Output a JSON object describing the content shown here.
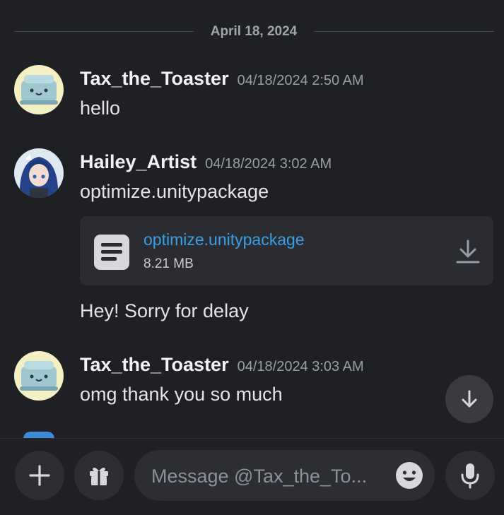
{
  "divider": {
    "date": "April 18, 2024"
  },
  "messages": [
    {
      "username": "Tax_the_Toaster",
      "timestamp": "04/18/2024 2:50 AM",
      "avatar_icon": "toaster-avatar-icon",
      "lines": [
        "hello"
      ]
    },
    {
      "username": "Hailey_Artist",
      "timestamp": "04/18/2024 3:02 AM",
      "avatar_icon": "anime-girl-avatar-icon",
      "lines": [
        "optimize.unitypackage",
        "Hey! Sorry for delay"
      ],
      "attachment": {
        "file_name": "optimize.unitypackage",
        "file_size": "8.21 MB",
        "icon": "document-icon",
        "action_icon": "download-icon"
      }
    },
    {
      "username": "Tax_the_Toaster",
      "timestamp": "04/18/2024 3:03 AM",
      "avatar_icon": "toaster-avatar-icon",
      "lines": [
        "omg thank you so much"
      ]
    }
  ],
  "composer": {
    "placeholder": "Message @Tax_the_To...",
    "value": "",
    "buttons": [
      "plus-icon",
      "gift-icon",
      "emoji-icon",
      "microphone-icon"
    ]
  },
  "colors": {
    "background": "#1f2024",
    "link": "#3b9fe6",
    "attachment_bg": "#2b2c31",
    "button_bg": "#2d2e33"
  }
}
